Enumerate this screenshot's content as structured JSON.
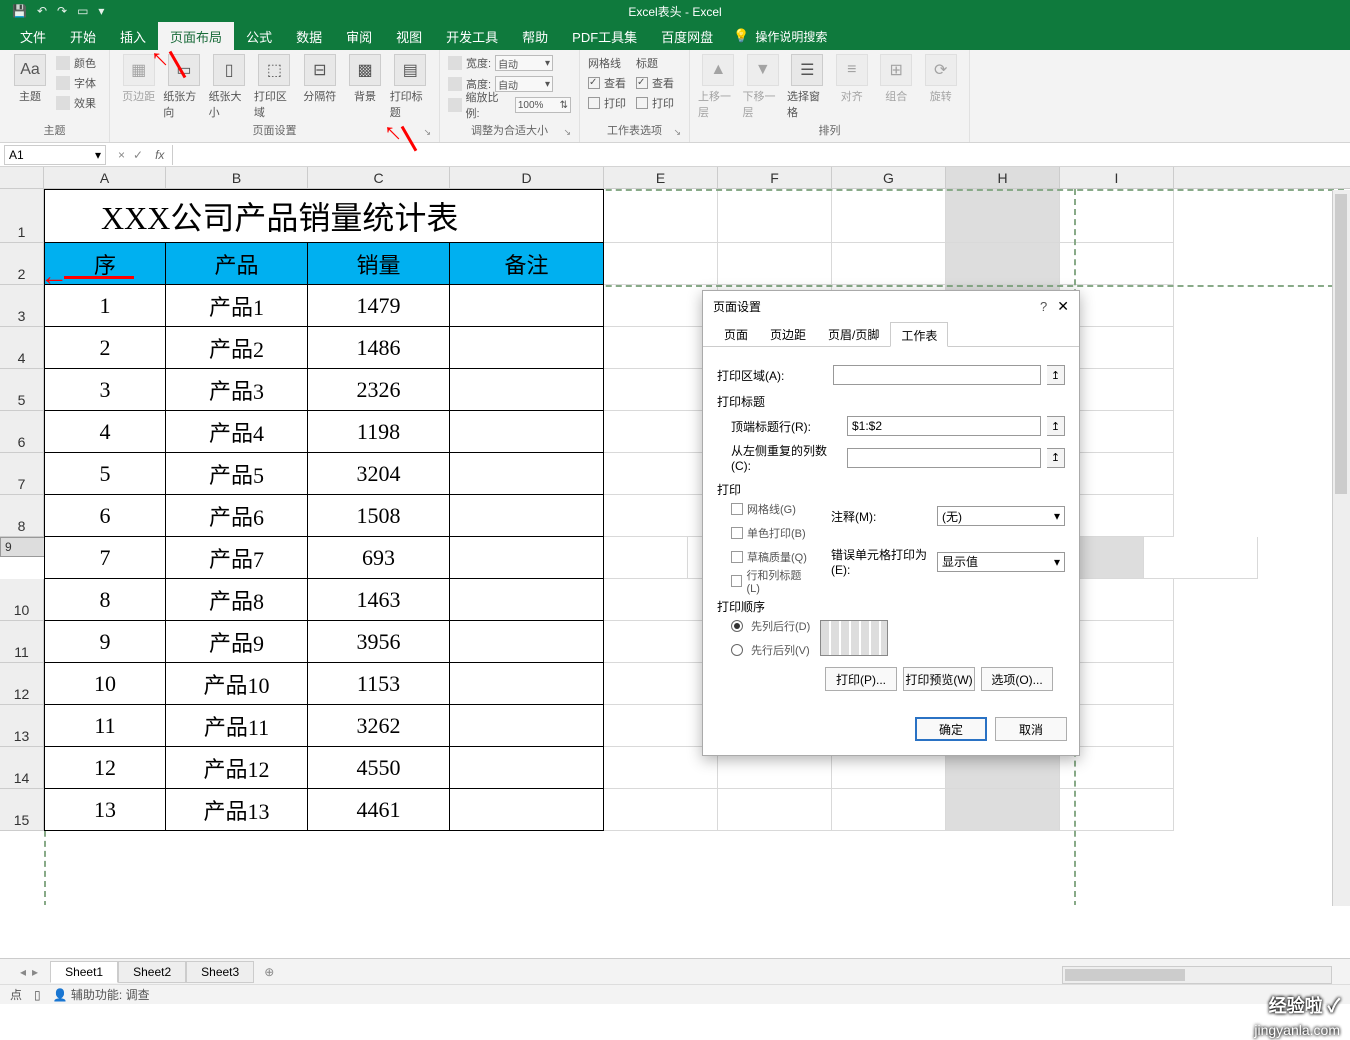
{
  "titlebar": {
    "title": "Excel表头 - Excel"
  },
  "qat": {
    "save": "💾",
    "undo": "↶",
    "redo": "↷",
    "new": "▭",
    "more": "▾"
  },
  "menu": {
    "file": "文件",
    "home": "开始",
    "insert": "插入",
    "layout": "页面布局",
    "formula": "公式",
    "data": "数据",
    "review": "审阅",
    "view": "视图",
    "dev": "开发工具",
    "help": "帮助",
    "pdf": "PDF工具集",
    "baidu": "百度网盘",
    "tellme": "操作说明搜索"
  },
  "ribbon": {
    "themes": {
      "label": "主题",
      "theme": "主题",
      "colors": "颜色",
      "fonts": "字体",
      "effects": "效果"
    },
    "pagesetup": {
      "label": "页面设置",
      "margins": "页边距",
      "orient": "纸张方向",
      "size": "纸张大小",
      "area": "打印区域",
      "breaks": "分隔符",
      "bg": "背景",
      "titles": "打印标题"
    },
    "scale": {
      "label": "调整为合适大小",
      "width": "宽度:",
      "height": "高度:",
      "ratio": "缩放比例:",
      "auto": "自动",
      "pct": "100%"
    },
    "sheetopt": {
      "label": "工作表选项",
      "grid": "网格线",
      "head": "标题",
      "view": "查看",
      "print": "打印"
    },
    "arrange": {
      "label": "排列",
      "fwd": "上移一层",
      "bwd": "下移一层",
      "pane": "选择窗格",
      "align": "对齐",
      "group": "组合",
      "rotate": "旋转"
    }
  },
  "namebox": "A1",
  "columns": [
    "A",
    "B",
    "C",
    "D",
    "E",
    "F",
    "G",
    "H",
    "I"
  ],
  "rows": [
    "1",
    "2",
    "3",
    "4",
    "5",
    "6",
    "7",
    "8",
    "9",
    "10",
    "11",
    "12",
    "13",
    "14",
    "15"
  ],
  "table": {
    "title": "XXX公司产品销量统计表",
    "headers": [
      "序",
      "产品",
      "销量",
      "备注"
    ],
    "data": [
      [
        "1",
        "产品1",
        "1479",
        ""
      ],
      [
        "2",
        "产品2",
        "1486",
        ""
      ],
      [
        "3",
        "产品3",
        "2326",
        ""
      ],
      [
        "4",
        "产品4",
        "1198",
        ""
      ],
      [
        "5",
        "产品5",
        "3204",
        ""
      ],
      [
        "6",
        "产品6",
        "1508",
        ""
      ],
      [
        "7",
        "产品7",
        "693",
        ""
      ],
      [
        "8",
        "产品8",
        "1463",
        ""
      ],
      [
        "9",
        "产品9",
        "3956",
        ""
      ],
      [
        "10",
        "产品10",
        "1153",
        ""
      ],
      [
        "11",
        "产品11",
        "3262",
        ""
      ],
      [
        "12",
        "产品12",
        "4550",
        ""
      ],
      [
        "13",
        "产品13",
        "4461",
        ""
      ]
    ]
  },
  "dialog": {
    "title": "页面设置",
    "tabs": {
      "page": "页面",
      "margin": "页边距",
      "hf": "页眉/页脚",
      "sheet": "工作表"
    },
    "printarea": "打印区域(A):",
    "printtitles": "打印标题",
    "toprows": "顶端标题行(R):",
    "toprows_val": "$1:$2",
    "leftcols": "从左侧重复的列数(C):",
    "print_section": "打印",
    "gridlines": "网格线(G)",
    "bw": "单色打印(B)",
    "draft": "草稿质量(Q)",
    "rowcol": "行和列标题(L)",
    "comments": "注释(M):",
    "comments_val": "(无)",
    "errors": "错误单元格打印为(E):",
    "errors_val": "显示值",
    "order": "打印顺序",
    "down": "先列后行(D)",
    "over": "先行后列(V)",
    "btn_print": "打印(P)...",
    "btn_preview": "打印预览(W)",
    "btn_options": "选项(O)...",
    "ok": "确定",
    "cancel": "取消"
  },
  "sheets": {
    "s1": "Sheet1",
    "s2": "Sheet2",
    "s3": "Sheet3"
  },
  "status": {
    "ready": "点",
    "acc": "辅助功能: 调查"
  },
  "watermark": {
    "brand": "经验啦",
    "url": "jingyanla.com"
  }
}
